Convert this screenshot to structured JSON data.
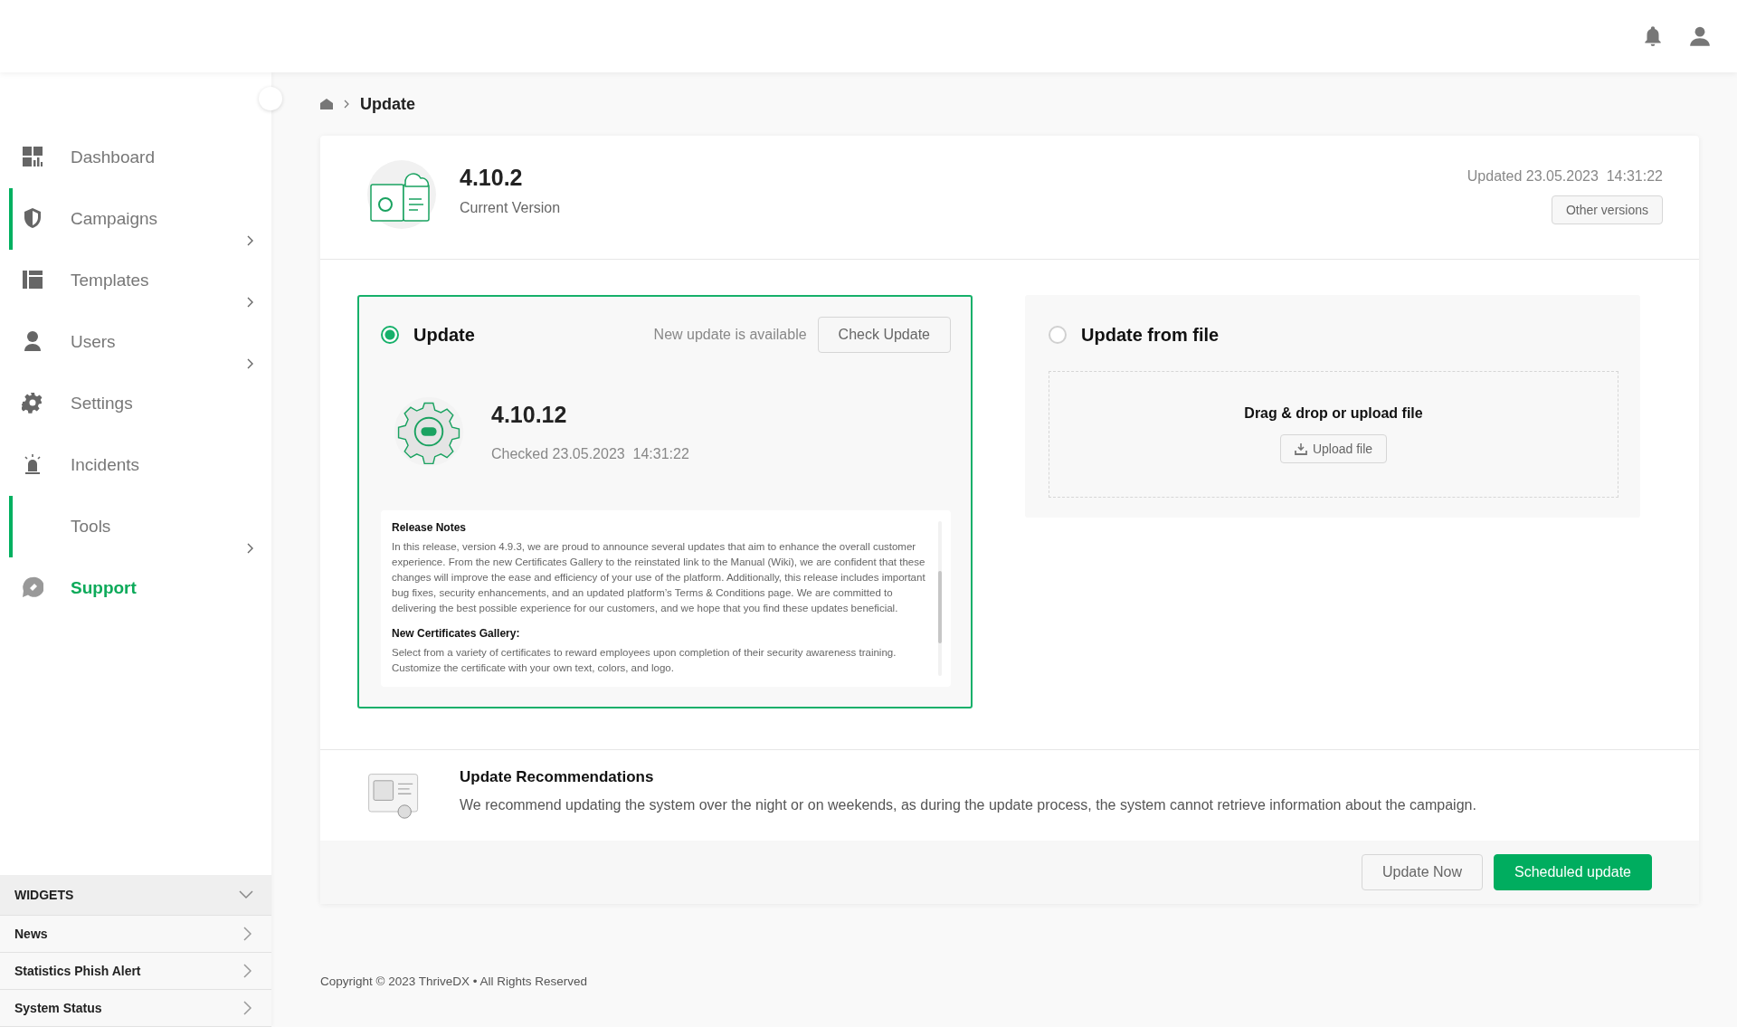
{
  "breadcrumb": {
    "current": "Update"
  },
  "sidebar": {
    "items": [
      {
        "label": "Dashboard",
        "selected": false,
        "accent": false,
        "has_submenu": false
      },
      {
        "label": "Campaigns",
        "selected": false,
        "accent": true,
        "has_submenu": true
      },
      {
        "label": "Templates",
        "selected": false,
        "accent": false,
        "has_submenu": true
      },
      {
        "label": "Users",
        "selected": false,
        "accent": false,
        "has_submenu": true
      },
      {
        "label": "Settings",
        "selected": false,
        "accent": false,
        "has_submenu": false
      },
      {
        "label": "Incidents",
        "selected": false,
        "accent": false,
        "has_submenu": false
      },
      {
        "label": "Tools",
        "selected": false,
        "accent": true,
        "has_submenu": true
      },
      {
        "label": "Support",
        "selected": true,
        "accent": false,
        "has_submenu": false
      }
    ],
    "widgets": {
      "title": "WIDGETS",
      "expanded": true,
      "items": [
        "News",
        "Statistics Phish Alert",
        "System Status"
      ]
    }
  },
  "current_version": {
    "version": "4.10.2",
    "label": "Current Version",
    "updated": "Updated 23.05.2023  14:31:22",
    "button": "Other versions"
  },
  "options": [
    {
      "kind": "online",
      "title": "Update",
      "selected": true,
      "status": "New update is available",
      "button": "Check Update",
      "version": "4.10.12",
      "checked": "Checked 23.05.2023  14:31:22",
      "notes": [
        {
          "heading": "Release Notes",
          "text": "In this release, version 4.9.3, we are proud to announce several updates that aim to enhance the overall customer experience. From the new Certificates Gallery to the reinstated link to the Manual (Wiki), we are confident that these changes will improve the ease and efficiency of your use of the platform. Additionally, this release includes important bug fixes, security enhancements, and an updated platform’s Terms & Conditions page. We are committed to delivering the best possible experience for our customers, and we hope that you find these updates beneficial."
        },
        {
          "heading": "New Certificates Gallery:",
          "text": "Select from a variety of certificates to reward employees upon completion of their security awareness training. Customize the certificate with your own text, colors, and logo."
        }
      ]
    },
    {
      "kind": "file",
      "title": "Update from file",
      "selected": false,
      "drop_text": "Drag & drop or upload file",
      "button": "Upload file"
    }
  ],
  "recommendations": {
    "title": "Update Recommendations",
    "text": "We recommend updating the system over the night or on weekends, as during the update process, the system cannot retrieve information about the campaign."
  },
  "actions": [
    {
      "label": "Update Now",
      "kind": "secondary"
    },
    {
      "label": "Scheduled update",
      "kind": "primary"
    }
  ],
  "footer": {
    "copyright": "Copyright © 2023 ThriveDX • All Rights Reserved"
  }
}
